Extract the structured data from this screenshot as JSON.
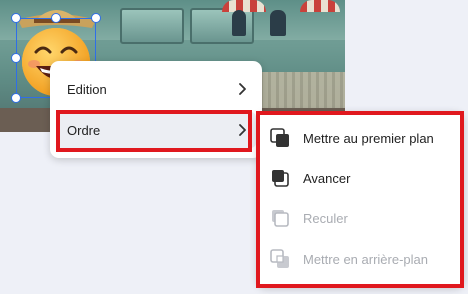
{
  "menu": {
    "items": [
      {
        "label": "Edition",
        "has_submenu": true
      },
      {
        "label": "Ordre",
        "has_submenu": true,
        "active": true
      }
    ]
  },
  "submenu": {
    "items": [
      {
        "label": "Mettre au premier plan",
        "icon": "bring-to-front-icon",
        "enabled": true
      },
      {
        "label": "Avancer",
        "icon": "bring-forward-icon",
        "enabled": true
      },
      {
        "label": "Reculer",
        "icon": "send-backward-icon",
        "enabled": false
      },
      {
        "label": "Mettre en arrière-plan",
        "icon": "send-to-back-icon",
        "enabled": false
      }
    ]
  },
  "colors": {
    "highlight": "#e0181e",
    "selection": "#2f6ee8",
    "enabled_text": "#222222",
    "disabled_text": "#a9acb2"
  }
}
